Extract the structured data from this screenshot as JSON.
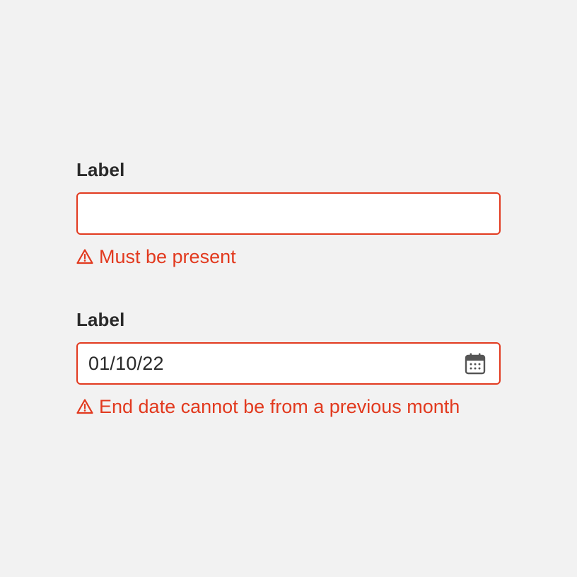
{
  "colors": {
    "background": "#f2f2f2",
    "error": "#e23a1f",
    "label_text": "#2a2a2a",
    "input_background": "#ffffff",
    "icon": "#555555"
  },
  "fields": [
    {
      "label": "Label",
      "value": "",
      "error_icon": "warning-triangle-icon",
      "error_message": "Must be present"
    },
    {
      "label": "Label",
      "value": "01/10/22",
      "trailing_icon": "calendar-icon",
      "error_icon": "warning-triangle-icon",
      "error_message": "End date cannot be from a previous month"
    }
  ]
}
